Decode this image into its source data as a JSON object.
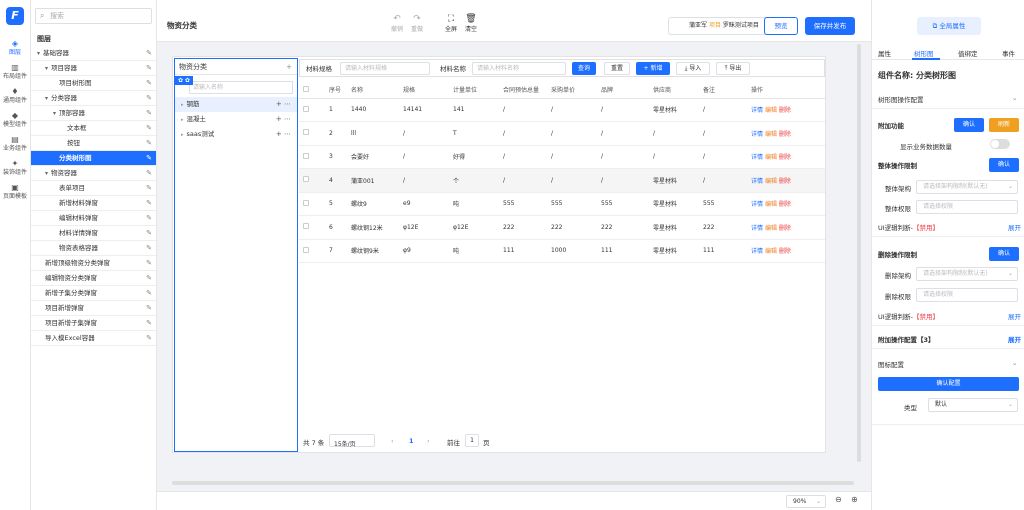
{
  "rail": {
    "logo": "F",
    "items": [
      {
        "label": "图层",
        "icon": "layers-icon",
        "glyph": "◈"
      },
      {
        "label": "布局组件",
        "icon": "layout-icon",
        "glyph": "▥"
      },
      {
        "label": "通用组件",
        "icon": "general-icon",
        "glyph": "♦"
      },
      {
        "label": "模型组件",
        "icon": "model-icon",
        "glyph": "◆"
      },
      {
        "label": "业务组件",
        "icon": "business-icon",
        "glyph": "▤"
      },
      {
        "label": "装饰组件",
        "icon": "decoration-icon",
        "glyph": "✦"
      },
      {
        "label": "页面模板",
        "icon": "template-icon",
        "glyph": "▣"
      }
    ]
  },
  "tree": {
    "search_placeholder": "搜索",
    "title": "图层",
    "nodes": [
      {
        "label": "基础容器",
        "level": "lvl0",
        "caret": "▾"
      },
      {
        "label": "项目容器",
        "level": "lvl1",
        "caret": "▾"
      },
      {
        "label": "项目树形图",
        "level": "lvl2b",
        "caret": ""
      },
      {
        "label": "分类容器",
        "level": "lvl1",
        "caret": "▾"
      },
      {
        "label": "顶部容器",
        "level": "lvl2",
        "caret": "▾"
      },
      {
        "label": "文本框",
        "level": "lvl3",
        "caret": ""
      },
      {
        "label": "按钮",
        "level": "lvl3",
        "caret": ""
      },
      {
        "label": "分类树形图",
        "level": "lvl2b",
        "caret": "",
        "selected": true
      },
      {
        "label": "物资容器",
        "level": "lvl1",
        "caret": "▾"
      },
      {
        "label": "表单项目",
        "level": "lvl2b",
        "caret": ""
      },
      {
        "label": "新增材料弹窗",
        "level": "lvl2b",
        "caret": ""
      },
      {
        "label": "编辑材料弹窗",
        "level": "lvl2b",
        "caret": ""
      },
      {
        "label": "材料详情弹窗",
        "level": "lvl2b",
        "caret": ""
      },
      {
        "label": "物资表格容器",
        "level": "lvl2b",
        "caret": ""
      },
      {
        "label": "新增顶级物资分类弹窗",
        "level": "lvl0b",
        "caret": ""
      },
      {
        "label": "编辑物资分类弹窗",
        "level": "lvl0b",
        "caret": ""
      },
      {
        "label": "新增子集分类弹窗",
        "level": "lvl0b",
        "caret": ""
      },
      {
        "label": "项目新增弹窗",
        "level": "lvl0b",
        "caret": ""
      },
      {
        "label": "项目新增子集弹窗",
        "level": "lvl0b",
        "caret": ""
      },
      {
        "label": "导入模Excel容器",
        "level": "lvl0b",
        "caret": ""
      }
    ]
  },
  "topbar": {
    "title": "物资分类",
    "tools": [
      {
        "label": "撤销",
        "glyph": "↶",
        "icon": "undo-icon",
        "dark": false
      },
      {
        "label": "重做",
        "glyph": "↷",
        "icon": "redo-icon",
        "dark": false
      },
      {
        "label": "全屏",
        "glyph": "⛶",
        "icon": "fullscreen-icon",
        "dark": true
      },
      {
        "label": "清空",
        "glyph": "🗑",
        "icon": "trash-icon",
        "dark": true
      }
    ],
    "project_prefix": "蒲亚军",
    "project_tag": "项目",
    "project_name": "罗眯测试项目",
    "preview": "预览",
    "save_publish": "保存并发布"
  },
  "canvas": {
    "left": {
      "title": "物资分类",
      "tag": "✿ ✿",
      "input_placeholder": "请输入名称",
      "categories": [
        {
          "name": "钢筋",
          "highlight": true,
          "acts": "+ ⋯"
        },
        {
          "name": "混凝土",
          "highlight": false,
          "acts": "+ ⋯"
        },
        {
          "name": "saas测试",
          "highlight": false,
          "acts": "+ ⋯"
        }
      ]
    },
    "filter": {
      "spec_label": "材料规格",
      "spec_placeholder": "请输入材料规格",
      "name_label": "材料名称",
      "name_placeholder": "请输入材料名称",
      "query": "查询",
      "reset": "重置",
      "add": "+ 新增",
      "import": "⤓ 导入",
      "export": "⤒ 导出"
    },
    "table": {
      "headers": [
        "",
        "序号",
        "名称",
        "规格",
        "计量单位",
        "合同预估总量",
        "采购单价",
        "品牌",
        "供应商",
        "备注",
        "操作"
      ],
      "rows": [
        [
          "1",
          "1440",
          "14141",
          "141",
          "/",
          "/",
          "/",
          "零星材料",
          "/"
        ],
        [
          "2",
          "lll",
          "/",
          "T",
          "/",
          "/",
          "/",
          "/",
          "/"
        ],
        [
          "3",
          "会要好",
          "/",
          "好得",
          "/",
          "/",
          "/",
          "/",
          "/"
        ],
        [
          "4",
          "蒲亚001",
          "/",
          "个",
          "/",
          "/",
          "/",
          "零星材料",
          "/"
        ],
        [
          "5",
          "螺纹9",
          "e9",
          "吨",
          "555",
          "555",
          "555",
          "零星材料",
          "555"
        ],
        [
          "6",
          "螺纹钢12米",
          "φ12E",
          "φ12E",
          "222",
          "222",
          "222",
          "零星材料",
          "222"
        ],
        [
          "7",
          "螺纹钢9米",
          "φ9",
          "吨",
          "111",
          "1000",
          "111",
          "零星材料",
          "111"
        ]
      ],
      "actions": {
        "detail": "详情",
        "edit": "编辑",
        "delete": "删除"
      }
    },
    "pager": {
      "total": "共 7 条",
      "size": "15条/页",
      "prev": "‹",
      "page": "1",
      "next": "›",
      "goto": "前往",
      "goto_value": "1",
      "page_unit": "页"
    }
  },
  "zoom": {
    "value": "90%",
    "zoom_out": "⊖",
    "zoom_in": "⊕"
  },
  "rpanel": {
    "global": "⧉ 全局属性",
    "tabs": [
      "属性",
      "树形图",
      "值绑定",
      "事件"
    ],
    "active_tab": 1,
    "comp_name": "组件名称: 分类树形图",
    "tree_config": "树形图操作配置",
    "attach": "附加功能",
    "confirm": "确认",
    "refresh": "刷新",
    "show_count": "显示业务数据数量",
    "overall_limit": "整体操作限制",
    "overall_arch": "整体架构",
    "overall_arch_ph": "请选择架构限制(默认无)",
    "overall_perm": "整体权限",
    "overall_perm_ph": "请选择权限",
    "ui_logic": "UI逻辑判断-",
    "disabled": "【禁用】",
    "expand": "展开",
    "delete_limit": "删除操作限制",
    "delete_arch": "删除架构",
    "delete_arch_ph": "请选择架构限制(默认无)",
    "delete_perm": "删除权限",
    "delete_perm_ph": "请选择权限",
    "extra_config": "附加操作配置【3】",
    "icon_config": "图标配置",
    "confirm_config": "确认配置",
    "type_label": "类型",
    "type_value": "默认"
  }
}
